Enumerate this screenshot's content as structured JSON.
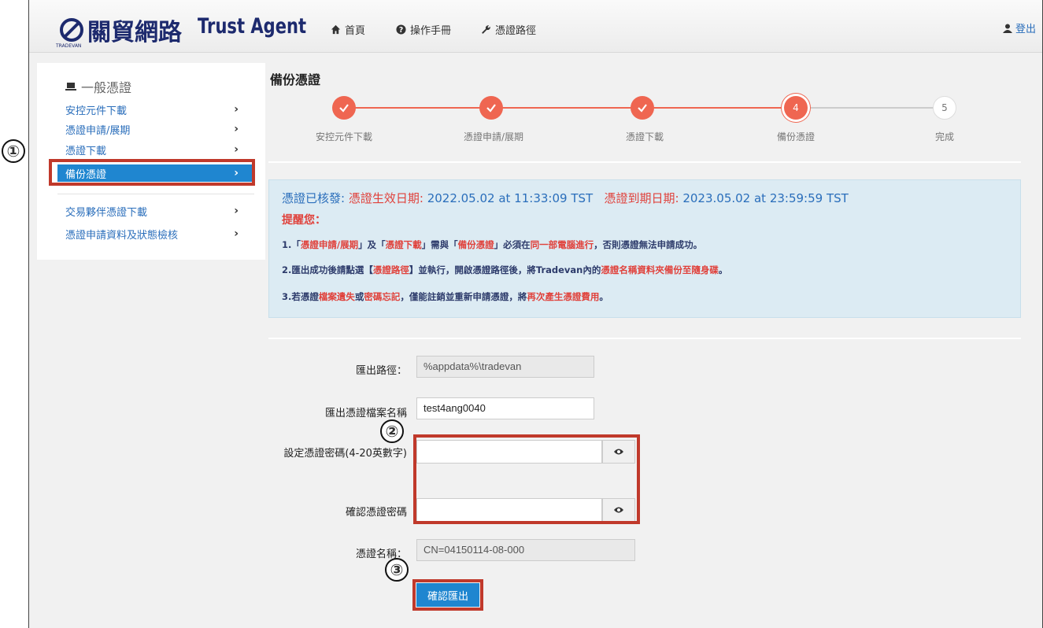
{
  "header": {
    "logo_cn": "關貿網路",
    "logo_en": "Trust Agent",
    "logo_sub": "TRADEVAN",
    "nav": [
      {
        "label": "首頁",
        "icon": "home-icon"
      },
      {
        "label": "操作手冊",
        "icon": "question-circle-icon"
      },
      {
        "label": "憑證路徑",
        "icon": "wrench-icon"
      }
    ],
    "logout_label": "登出"
  },
  "sidebar": {
    "title": "一般憑證",
    "items": [
      {
        "label": "安控元件下載"
      },
      {
        "label": "憑證申請/展期"
      },
      {
        "label": "憑證下載"
      },
      {
        "label": "備份憑證",
        "active": true
      },
      {
        "label": "交易夥伴憑證下載"
      },
      {
        "label": "憑證申請資料及狀態檢核"
      }
    ]
  },
  "main": {
    "title": "備份憑證",
    "steps": [
      {
        "label": "安控元件下載",
        "state": "done",
        "num": "1"
      },
      {
        "label": "憑證申請/展期",
        "state": "done",
        "num": "2"
      },
      {
        "label": "憑證下載",
        "state": "done",
        "num": "3"
      },
      {
        "label": "備份憑證",
        "state": "current",
        "num": "4"
      },
      {
        "label": "完成",
        "state": "todo",
        "num": "5"
      }
    ],
    "info": {
      "issued_label": "憑證已核發:",
      "start_label": "憑證生效日期:",
      "start_value": "2022.05.02 at 11:33:09 TST",
      "end_label": "憑證到期日期:",
      "end_value": "2023.05.02 at 23:59:59 TST",
      "remind_title": "提醒您：",
      "note1": {
        "p1": "1.「",
        "r1": "憑證申請/展期",
        "p2": "」及「",
        "r2": "憑證下載",
        "p3": "」需與「",
        "r3": "備份憑證",
        "p4": "」必須在",
        "r4": "同一部電腦進行",
        "p5": "，否則憑證無法申請成功。"
      },
      "note2": {
        "p1": "2.匯出成功後請點選【",
        "r1": "憑證路徑",
        "p2": "】並執行，開啟憑證路徑後，將Tradevan內的",
        "r2": "憑證名稱資料夾備份至隨身碟",
        "p3": "。"
      },
      "note3": {
        "p1": "3.若憑證",
        "r1": "檔案遺失",
        "p2": "或",
        "r2": "密碼忘記",
        "p3": "，僅能註銷並重新申請憑證，將",
        "r3": "再次產生憑證費用",
        "p4": "。"
      }
    },
    "form": {
      "export_path_label": "匯出路徑：",
      "export_path_value": "%appdata%\\tradevan",
      "file_name_label": "匯出憑證檔案名稱",
      "file_name_value": "test4ang0040",
      "password_label": "設定憑證密碼(4-20英數字)",
      "password_value": "",
      "confirm_label": "確認憑證密碼",
      "confirm_value": "",
      "cert_name_label": "憑證名稱：",
      "cert_name_value": "CN=04150114-08-000",
      "submit_label": "確認匯出"
    }
  },
  "markers": [
    "①",
    "②",
    "③"
  ],
  "colors": {
    "accent": "#1f86d0",
    "step": "#ef6651",
    "alert": "#e0413b",
    "highlight_box": "#c0392b"
  }
}
